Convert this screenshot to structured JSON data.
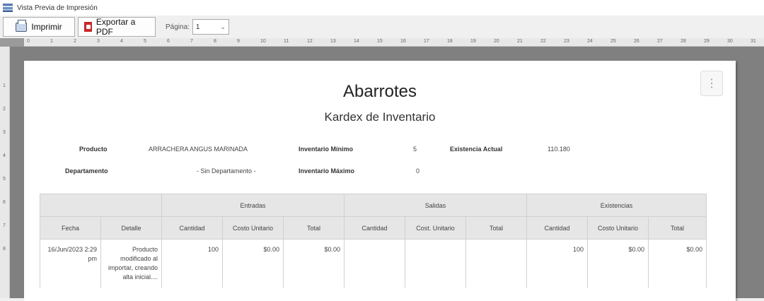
{
  "window": {
    "title": "Vista Previa de Impresión"
  },
  "toolbar": {
    "print_label": "Imprimir",
    "pdf_label": "Exportar a PDF",
    "page_label": "Página:",
    "page_value": "1"
  },
  "ruler": {
    "top_ticks": [
      "0",
      "1",
      "2",
      "3",
      "4",
      "5",
      "6",
      "7",
      "8",
      "9",
      "10",
      "11",
      "12",
      "13",
      "14",
      "15",
      "16",
      "17",
      "18",
      "19",
      "20",
      "21",
      "22",
      "23",
      "24",
      "25",
      "26",
      "27",
      "28",
      "29",
      "30",
      "31"
    ],
    "left_ticks": [
      "1",
      "2",
      "3",
      "4",
      "5",
      "6",
      "7",
      "8"
    ]
  },
  "report": {
    "title": "Abarrotes",
    "subtitle": "Kardex de Inventario",
    "product_label": "Producto",
    "product_value": "ARRACHERA ANGUS MARINADA",
    "min_label": "Inventario Mínimo",
    "min_value": "5",
    "stock_label": "Existencia Actual",
    "stock_value": "110.180",
    "dept_label": "Departamento",
    "dept_value": "- Sin Departamento -",
    "max_label": "Inventario Máximo",
    "max_value": "0",
    "groups": [
      "Entradas",
      "Salidas",
      "Existencias"
    ],
    "columns": [
      "Fecha",
      "Detalle",
      "Cantidad",
      "Costo Unitario",
      "Total",
      "Cantidad",
      "Cost. Unitario",
      "Total",
      "Cantidad",
      "Costo Unitario",
      "Total"
    ],
    "rows": [
      [
        "16/Jun/2023 2:29 pm",
        "Producto modificado al importar, creando alta inicial....",
        "100",
        "$0.00",
        "$0.00",
        "",
        "",
        "",
        "100",
        "$0.00",
        "$0.00"
      ]
    ]
  }
}
